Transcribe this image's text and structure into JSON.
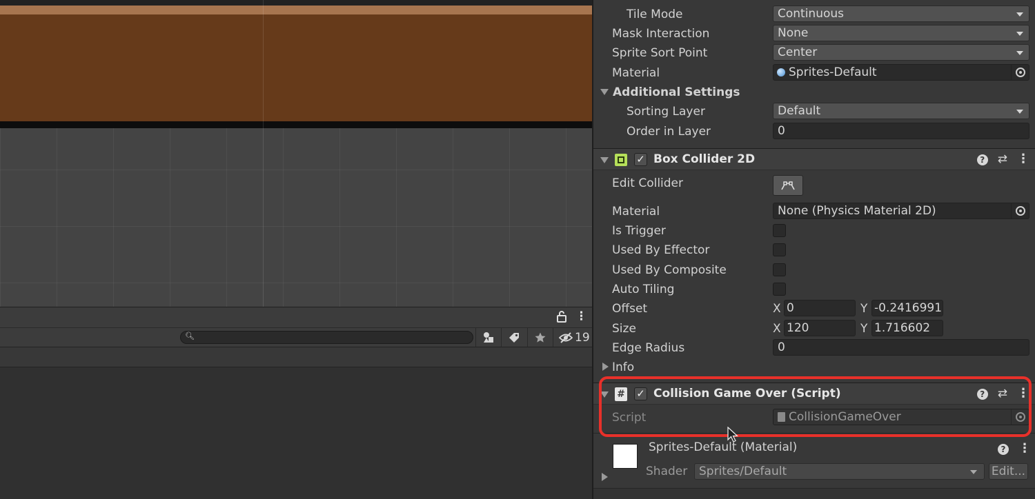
{
  "scene": {},
  "project": {
    "search_placeholder": "",
    "hidden_count": "19"
  },
  "inspector": {
    "sprite_renderer": {
      "tile_mode_label": "Tile Mode",
      "tile_mode_value": "Continuous",
      "mask_interaction_label": "Mask Interaction",
      "mask_interaction_value": "None",
      "sprite_sort_point_label": "Sprite Sort Point",
      "sprite_sort_point_value": "Center",
      "material_label": "Material",
      "material_value": "Sprites-Default",
      "additional_settings_label": "Additional Settings",
      "sorting_layer_label": "Sorting Layer",
      "sorting_layer_value": "Default",
      "order_in_layer_label": "Order in Layer",
      "order_in_layer_value": "0"
    },
    "box_collider": {
      "title": "Box Collider 2D",
      "enabled": true,
      "edit_collider_label": "Edit Collider",
      "material_label": "Material",
      "material_value": "None (Physics Material 2D)",
      "is_trigger_label": "Is Trigger",
      "used_by_effector_label": "Used By Effector",
      "used_by_composite_label": "Used By Composite",
      "auto_tiling_label": "Auto Tiling",
      "offset_label": "Offset",
      "offset_x": "0",
      "offset_y": "-0.2416991",
      "size_label": "Size",
      "size_x": "120",
      "size_y": "1.716602",
      "edge_radius_label": "Edge Radius",
      "edge_radius_value": "0",
      "x_label": "X",
      "y_label": "Y",
      "info_label": "Info"
    },
    "script_component": {
      "title": "Collision Game Over (Script)",
      "enabled": true,
      "script_label": "Script",
      "script_value": "CollisionGameOver"
    },
    "material_section": {
      "title": "Sprites-Default (Material)",
      "shader_label": "Shader",
      "shader_value": "Sprites/Default",
      "edit_label": "Edit..."
    }
  },
  "colors": {
    "ground_brown": "#663a1a",
    "highlight_red": "#e8302a",
    "collider_green": "#b6e05a"
  }
}
